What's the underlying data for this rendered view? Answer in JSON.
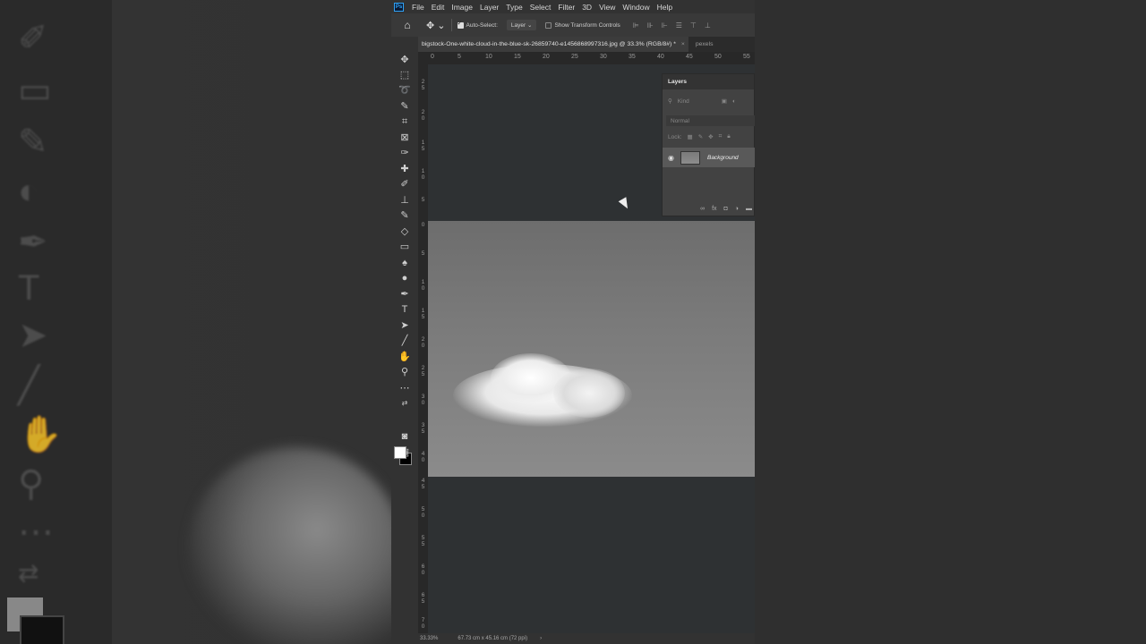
{
  "menubar": {
    "logo": "Ps",
    "items": [
      "File",
      "Edit",
      "Image",
      "Layer",
      "Type",
      "Select",
      "Filter",
      "3D",
      "View",
      "Window",
      "Help"
    ]
  },
  "options": {
    "auto_select_label": "Auto-Select:",
    "auto_select_checked": true,
    "target_value": "Layer",
    "show_transform_label": "Show Transform Controls",
    "show_transform_checked": false
  },
  "tabs": {
    "active_document": "bigstock-One-white-cloud-in-the-blue-sk-26859740-e1456868997316.jpg @ 33.3% (RGB/8#) *",
    "second_document": "pexels"
  },
  "ruler": {
    "horizontal": [
      "0",
      "5",
      "10",
      "15",
      "20",
      "25",
      "30",
      "35",
      "40",
      "45",
      "50",
      "55"
    ],
    "vertical": [
      "2\n5",
      "2\n0",
      "1\n5",
      "1\n0",
      "5",
      "0",
      "5",
      "1\n0",
      "1\n5",
      "2\n0",
      "2\n5",
      "3\n0",
      "3\n5",
      "4\n0",
      "4\n5",
      "5\n0",
      "5\n5",
      "6\n0",
      "6\n5",
      "7\n0"
    ]
  },
  "layers_panel": {
    "title": "Layers",
    "filter_placeholder": "Kind",
    "blend_mode": "Normal",
    "lock_label": "Lock:",
    "layer_name": "Background",
    "footer_icons": [
      "link-icon",
      "fx-icon",
      "mask-icon",
      "adjustment-icon",
      "folder-icon"
    ]
  },
  "status": {
    "zoom": "33.33%",
    "size": "67.73 cm x 45.16 cm (72 ppi)",
    "arrow": "›"
  },
  "colors": {
    "foreground": "#ffffff",
    "background": "#000000",
    "app_bg": "#535353",
    "canvas_bg": "#2e3133"
  }
}
